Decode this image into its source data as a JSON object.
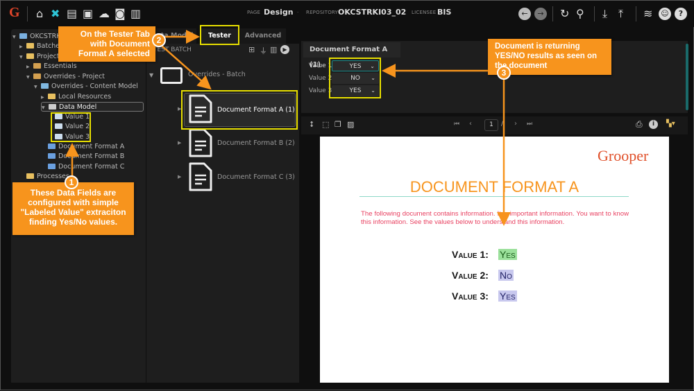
{
  "header": {
    "page_label": "PAGE",
    "page_value": "Design",
    "repo_label": "REPOSITORY",
    "repo_value": "OKCSTRKI03_02",
    "licensee_label": "LICENSEE",
    "licensee_value": "BIS",
    "nav_icons": [
      "home-icon",
      "design-tools-icon",
      "archive-icon",
      "media-icon",
      "cloud-upload-icon",
      "tasks-icon",
      "stats-icon"
    ],
    "right_icons": [
      "back-icon",
      "forward-icon",
      "refresh-icon",
      "search-icon",
      "download-icon",
      "upload-icon",
      "database-icon",
      "user-icon",
      "help-icon"
    ]
  },
  "tree": {
    "root": "OKCSTRKI03_02",
    "items": [
      "Batches",
      "Projects",
      "Essentials",
      "Overrides - Project",
      "Overrides - Content Model",
      "Local Resources",
      "Data Model",
      "Value 1",
      "Value 2",
      "Value 3",
      "Document Format A",
      "Document Format B",
      "Document Format C",
      "Processes"
    ]
  },
  "tabs": {
    "data_model": "Data Model",
    "tester": "Tester",
    "advanced": "Advanced"
  },
  "tester": {
    "batch_header": "TEST BATCH",
    "folder": "Overrides - Batch",
    "docs": [
      "Document Format A (1)",
      "Document Format B (2)",
      "Document Format C (3)"
    ]
  },
  "fields": {
    "title": "Document Format A (1)",
    "rows": [
      {
        "label": "Value 1",
        "value": "YES"
      },
      {
        "label": "Value 2",
        "value": "NO"
      },
      {
        "label": "Value 3",
        "value": "YES"
      }
    ]
  },
  "viewer": {
    "page_num": "1",
    "page_sep": "/"
  },
  "document": {
    "logo": "Grooper",
    "title": "DOCUMENT FORMAT A",
    "body": "The following document contains information. It is important information. You want to know this information. See the values below to understand this information.",
    "values": [
      {
        "label": "Value 1:",
        "value": "Yes"
      },
      {
        "label": "Value 2:",
        "value": "No"
      },
      {
        "label": "Value 3:",
        "value": "Yes"
      }
    ]
  },
  "callouts": {
    "one": {
      "num": "1",
      "text": "These Data Fields are configured with simple \"Labeled Value\" extraciton finding Yes/No values."
    },
    "two": {
      "num": "2",
      "text": "On the Tester Tab with Document Format A selected"
    },
    "three": {
      "num": "3",
      "text": "Document is returning YES/NO results as seen on the document"
    }
  },
  "colors": {
    "accent": "#f7941d",
    "highlight": "#e8e000",
    "teal": "#1a8a8a"
  }
}
